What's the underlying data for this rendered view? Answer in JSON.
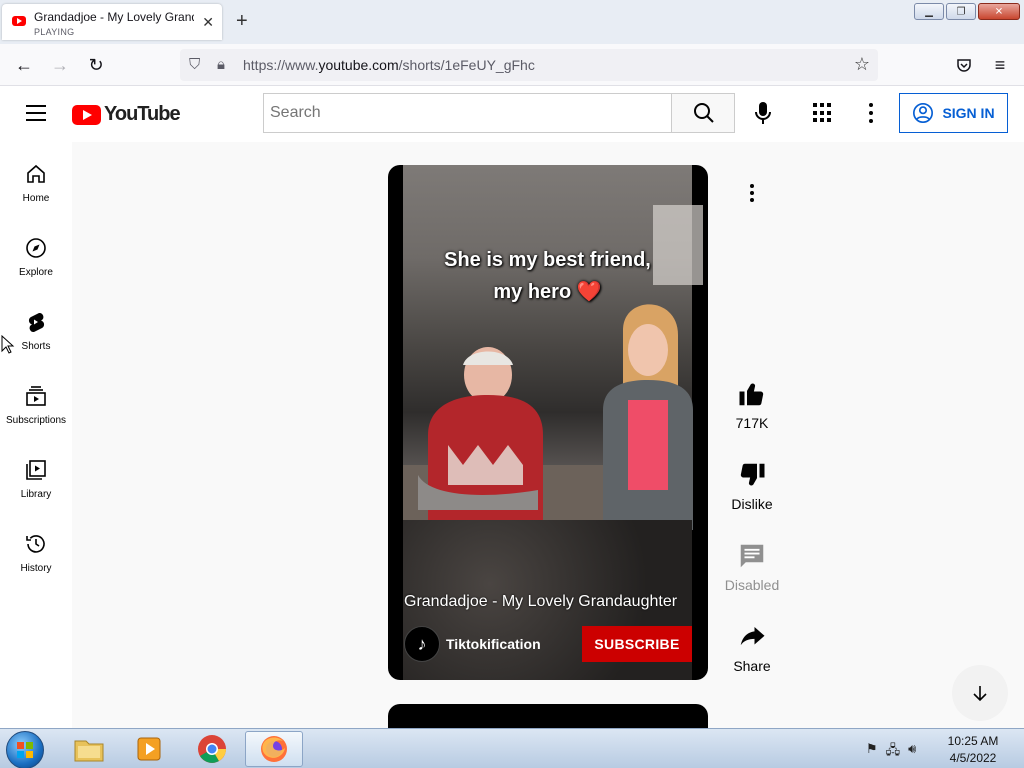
{
  "browser": {
    "tab": {
      "title": "Grandadjoe - My Lovely Granda",
      "status": "PLAYING"
    },
    "url": {
      "prefix": "https://www.",
      "domain": "youtube.com",
      "path": "/shorts/1eFeUY_gFhc"
    }
  },
  "youtube": {
    "logo_text": "YouTube",
    "search": {
      "placeholder": "Search"
    },
    "sign_in_label": "SIGN IN",
    "sidebar": [
      {
        "label": "Home",
        "icon": "home-icon"
      },
      {
        "label": "Explore",
        "icon": "explore-icon"
      },
      {
        "label": "Shorts",
        "icon": "shorts-icon"
      },
      {
        "label": "Subscriptions",
        "icon": "subscriptions-icon"
      },
      {
        "label": "Library",
        "icon": "library-icon"
      },
      {
        "label": "History",
        "icon": "history-icon"
      }
    ],
    "short": {
      "overlay_line1": "She is my best friend,",
      "overlay_line2": "my hero ❤️",
      "title": "Grandadjoe - My Lovely Grandaughter",
      "channel": "Tiktokification",
      "subscribe_label": "SUBSCRIBE"
    },
    "actions": {
      "likes": "717K",
      "dislike": "Dislike",
      "comments": "Disabled",
      "share": "Share"
    }
  },
  "taskbar": {
    "time": "10:25 AM",
    "date": "4/5/2022"
  },
  "colors": {
    "yt_red": "#ff0000",
    "subscribe_red": "#cc0000",
    "signin_blue": "#065fd4"
  }
}
